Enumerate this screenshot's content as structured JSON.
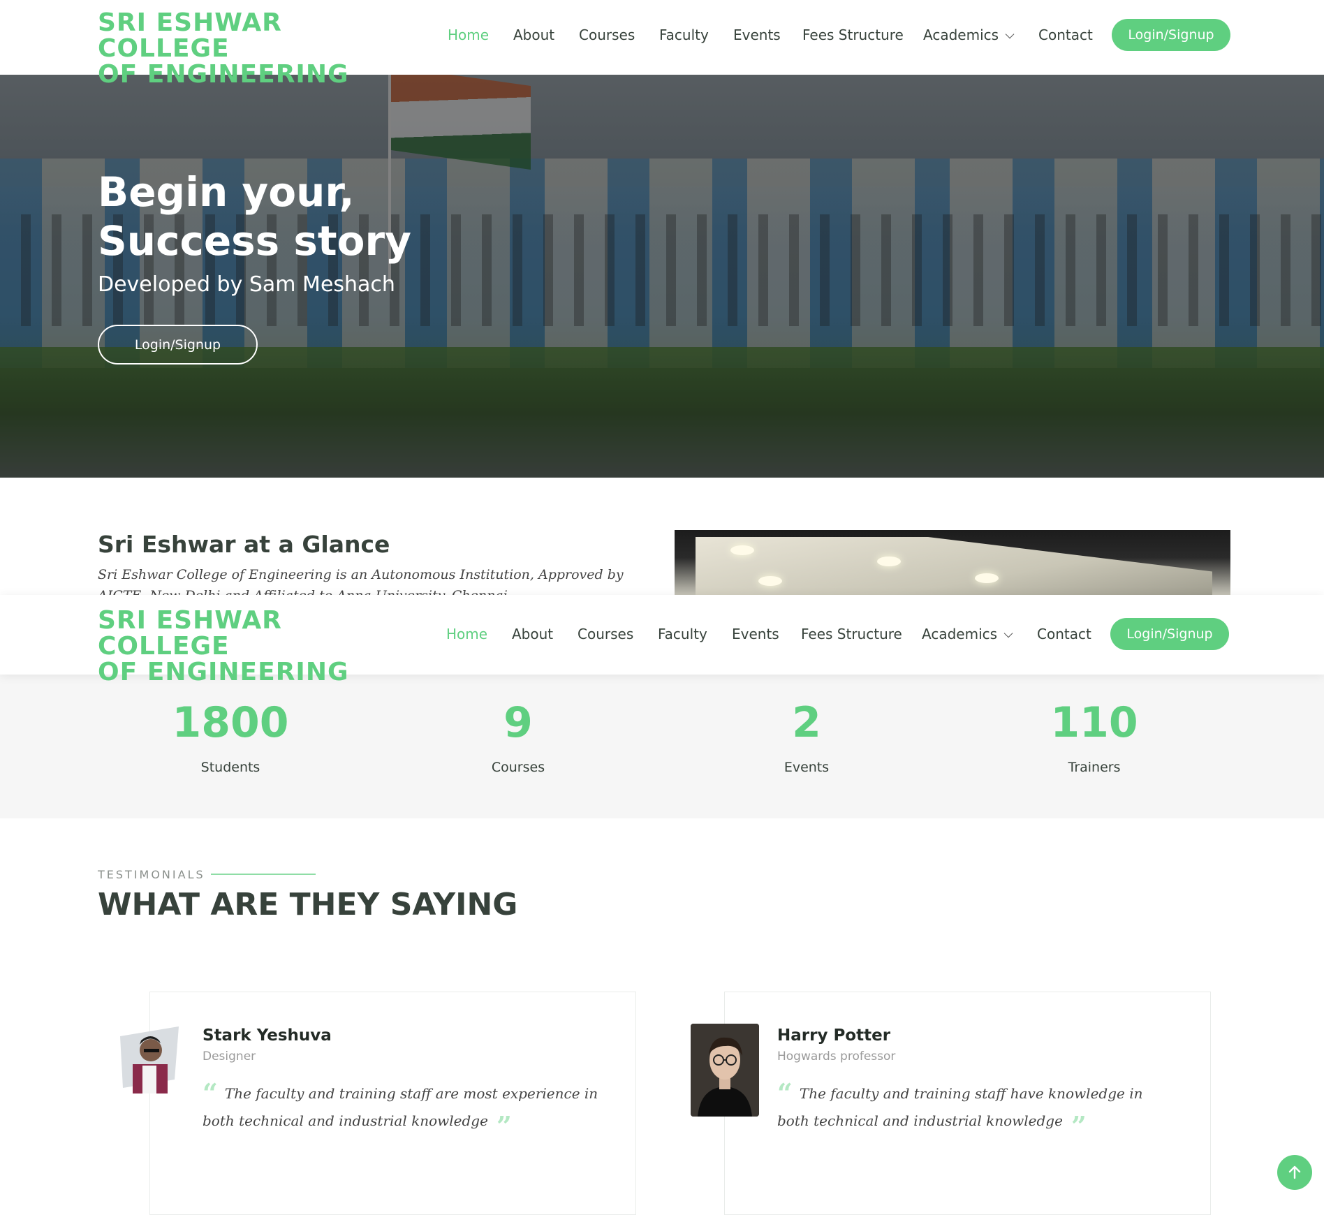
{
  "brand": {
    "line1": "SRI ESHWAR COLLEGE",
    "line2": "OF ENGINEERING",
    "accent_color": "#5fcf80"
  },
  "nav": {
    "items": [
      {
        "label": "Home",
        "active": true
      },
      {
        "label": "About"
      },
      {
        "label": "Courses"
      },
      {
        "label": "Faculty"
      },
      {
        "label": "Events"
      },
      {
        "label": "Fees Structure"
      },
      {
        "label": "Academics",
        "dropdown": true
      },
      {
        "label": "Contact"
      }
    ],
    "cta": "Login/Signup"
  },
  "hero": {
    "title_line1": "Begin your,",
    "title_line2": "Success story",
    "subtitle": "Developed by Sam Meshach",
    "button": "Login/Signup"
  },
  "about": {
    "title": "Sri Eshwar at a Glance",
    "text": "Sri Eshwar College of Engineering is an Autonomous Institution, Approved by AICTE, New Delhi and Affiliated to Anna University, Chennai."
  },
  "stats": [
    {
      "value": "1800",
      "label": "Students"
    },
    {
      "value": "9",
      "label": "Courses"
    },
    {
      "value": "2",
      "label": "Events"
    },
    {
      "value": "110",
      "label": "Trainers"
    }
  ],
  "testimonials": {
    "eyebrow": "TESTIMONIALS",
    "heading": "WHAT ARE THEY SAYING",
    "items": [
      {
        "name": "Stark Yeshuva",
        "role": "Designer",
        "quote": "The faculty and training staff are most experience in both technical and industrial knowledge"
      },
      {
        "name": "Harry Potter",
        "role": "Hogwards professor",
        "quote": "The faculty and training staff have knowledge in both technical and industrial knowledge"
      }
    ]
  },
  "icons": {
    "back_to_top": "arrow-up-icon",
    "dropdown": "chevron-down-icon",
    "quote_open": "quote-open-icon",
    "quote_close": "quote-close-icon"
  }
}
